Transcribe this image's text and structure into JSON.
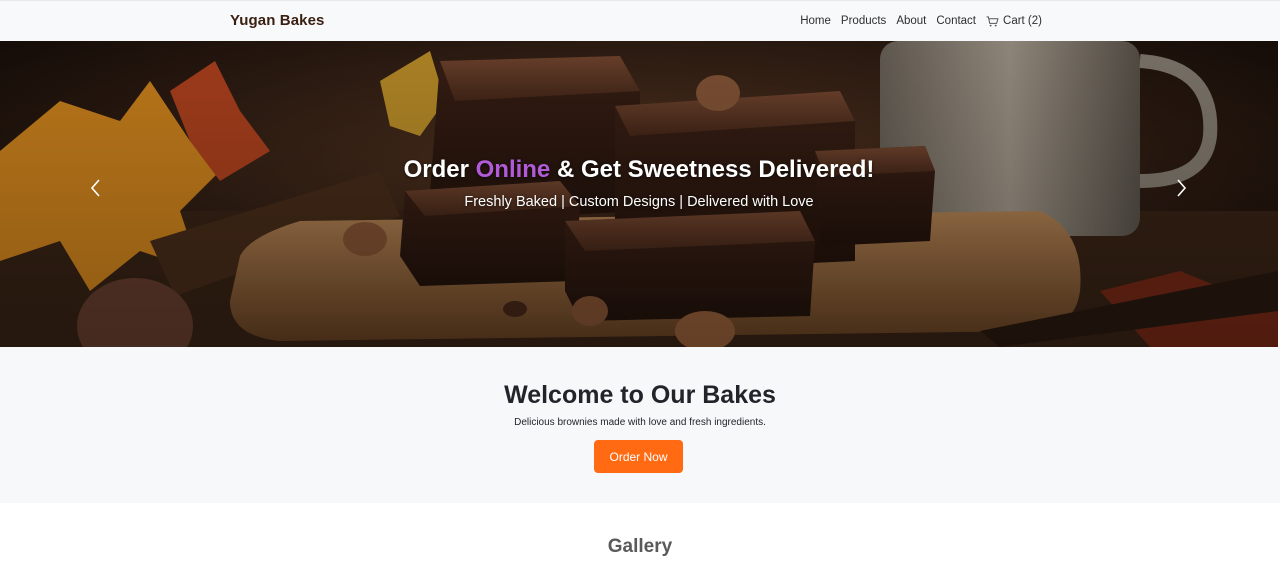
{
  "navbar": {
    "brand": "Yugan Bakes",
    "links": [
      {
        "label": "Home"
      },
      {
        "label": "Products"
      },
      {
        "label": "About"
      },
      {
        "label": "Contact"
      }
    ],
    "cart_label": "Cart (2)",
    "cart_icon": "cart-icon"
  },
  "hero": {
    "title_part1": "Order ",
    "title_accent": "Online",
    "title_part2": " & Get Sweetness Delivered!",
    "subtitle": "Freshly Baked | Custom Designs | Delivered with Love",
    "prev_icon": "chevron-left-icon",
    "next_icon": "chevron-right-icon",
    "accent_color": "#b15bd8"
  },
  "welcome": {
    "title": "Welcome to Our Bakes",
    "text": "Delicious brownies made with love and fresh ingredients.",
    "button_label": "Order Now",
    "button_color": "#ff6a13"
  },
  "gallery": {
    "title": "Gallery"
  }
}
